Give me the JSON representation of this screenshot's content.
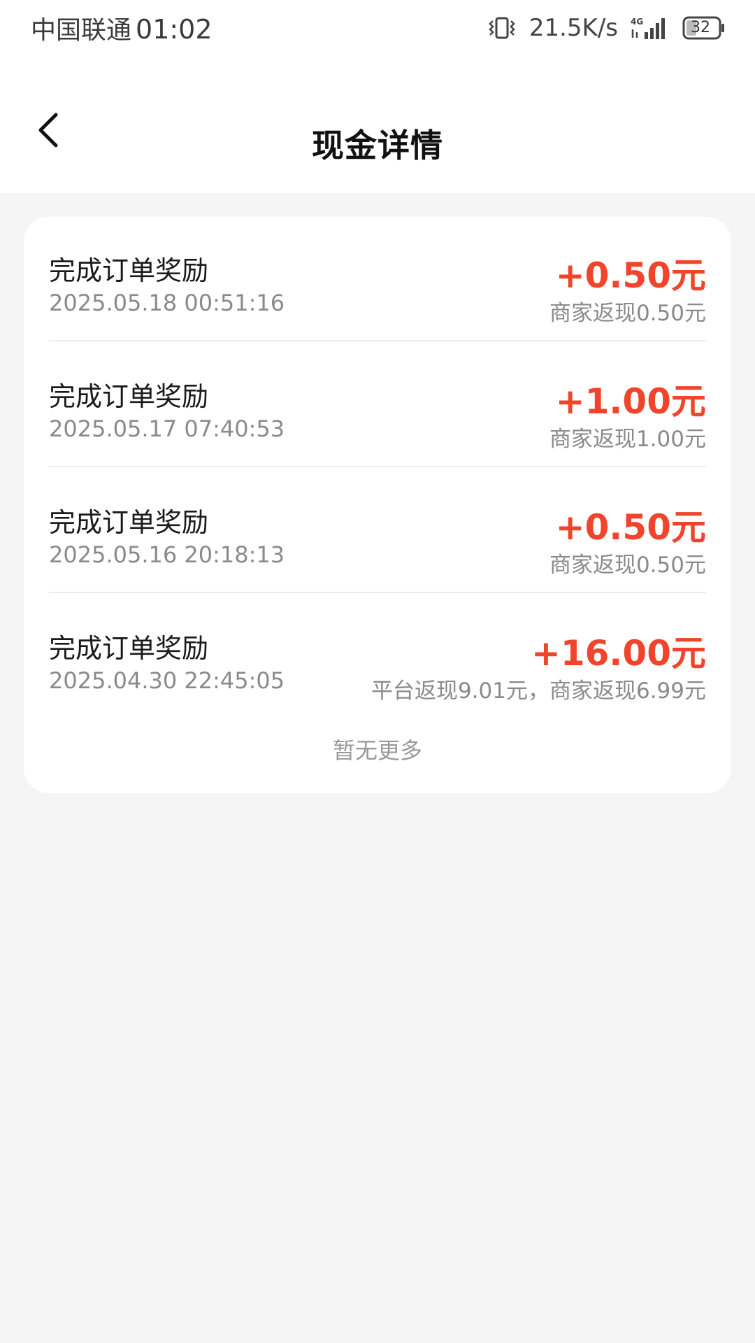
{
  "status_bar": {
    "carrier": "中国联通",
    "time": "01:02",
    "network_speed": "21.5K/s",
    "battery": "32",
    "icons": [
      "vibrate-icon",
      "signal-4g-icon",
      "battery-icon"
    ]
  },
  "header": {
    "title": "现金详情",
    "back_icon": "chevron-left-icon"
  },
  "records": [
    {
      "title": "完成订单奖励",
      "time": "2025.05.18 00:51:16",
      "amount": "+0.50元",
      "desc": "商家返现0.50元"
    },
    {
      "title": "完成订单奖励",
      "time": "2025.05.17 07:40:53",
      "amount": "+1.00元",
      "desc": "商家返现1.00元"
    },
    {
      "title": "完成订单奖励",
      "time": "2025.05.16 20:18:13",
      "amount": "+0.50元",
      "desc": "商家返现0.50元"
    },
    {
      "title": "完成订单奖励",
      "time": "2025.04.30 22:45:05",
      "amount": "+16.00元",
      "desc": "平台返现9.01元，商家返现6.99元"
    }
  ],
  "footer": {
    "no_more": "暂无更多"
  },
  "colors": {
    "amount": "#f0442c",
    "background": "#f5f5f5",
    "card": "#ffffff"
  }
}
